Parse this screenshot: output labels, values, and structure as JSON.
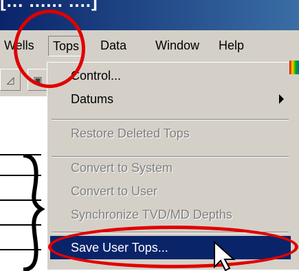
{
  "window": {
    "title": "[... ...... ....]"
  },
  "menubar": {
    "items": [
      {
        "label": "Wells"
      },
      {
        "label": "Tops"
      },
      {
        "label": "Data"
      },
      {
        "label": "Window"
      },
      {
        "label": "Help"
      }
    ]
  },
  "toolbar": {
    "icons": [
      "toolbar-button-icon",
      "toolbar-button-icon"
    ]
  },
  "tops_menu": {
    "items": [
      {
        "label": "Control...",
        "enabled": true
      },
      {
        "label": "Datums",
        "enabled": true,
        "submenu": true
      },
      {
        "label": "Restore Deleted Tops",
        "enabled": false
      },
      {
        "label": "Convert to System",
        "enabled": false
      },
      {
        "label": "Convert to User",
        "enabled": false
      },
      {
        "label": "Synchronize TVD/MD Depths",
        "enabled": false
      },
      {
        "label": "Save User Tops...",
        "enabled": true,
        "highlighted": true
      }
    ]
  },
  "annotations": {
    "highlight_color": "#e00000"
  },
  "colors": {
    "menu_bg": "#d4d0c8",
    "selection": "#0a246a",
    "title_bar": "#0a246a"
  }
}
